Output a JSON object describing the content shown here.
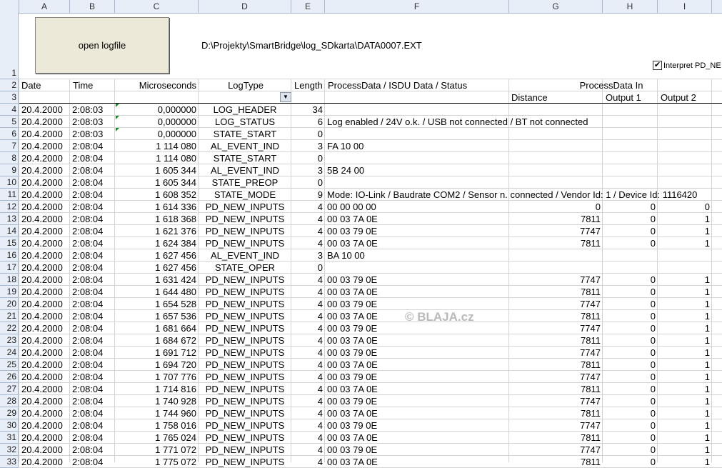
{
  "columns": [
    "A",
    "B",
    "C",
    "D",
    "E",
    "F",
    "G",
    "H",
    "I"
  ],
  "header_row1": {
    "button_label": "open logfile",
    "file_path": "D:\\Projekty\\SmartBridge\\log_SDkarta\\DATA0007.EXT",
    "checkbox_label": "Interpret PD_NE",
    "checkbox_mark": "✔"
  },
  "header_row2": {
    "date": "Date",
    "time": "Time",
    "micro": "Microseconds",
    "logtype": "LogType",
    "length": "Length",
    "process": "ProcessData / ISDU Data / Status",
    "pdin": "ProcessData In"
  },
  "header_row3": {
    "distance": "Distance",
    "out1": "Output 1",
    "out2": "Output 2",
    "filter_glyph": "▼"
  },
  "row_numbers": [
    "1",
    "2",
    "3",
    "4",
    "5",
    "6",
    "7",
    "8",
    "9",
    "10",
    "11",
    "12",
    "13",
    "14",
    "15",
    "16",
    "17",
    "18",
    "19",
    "20",
    "21",
    "22",
    "23",
    "24",
    "25",
    "26",
    "27",
    "28",
    "29",
    "30",
    "31",
    "32",
    "33"
  ],
  "rows": [
    {
      "date": "20.4.2000",
      "time": "2:08:03",
      "micro": "0,000000",
      "type": "LOG_HEADER",
      "len": "34",
      "data": "",
      "dist": "",
      "o1": "",
      "o2": ""
    },
    {
      "date": "20.4.2000",
      "time": "2:08:03",
      "micro": "0,000000",
      "type": "LOG_STATUS",
      "len": "6",
      "data": "Log enabled / 24V o.k. / USB not connected / BT not connected",
      "dist": "",
      "o1": "",
      "o2": ""
    },
    {
      "date": "20.4.2000",
      "time": "2:08:03",
      "micro": "0,000000",
      "type": "STATE_START",
      "len": "0",
      "data": "",
      "dist": "",
      "o1": "",
      "o2": ""
    },
    {
      "date": "20.4.2000",
      "time": "2:08:04",
      "micro": "1 114 080",
      "type": "AL_EVENT_IND",
      "len": "3",
      "data": "FA 10 00",
      "dist": "",
      "o1": "",
      "o2": ""
    },
    {
      "date": "20.4.2000",
      "time": "2:08:04",
      "micro": "1 114 080",
      "type": "STATE_START",
      "len": "0",
      "data": "",
      "dist": "",
      "o1": "",
      "o2": ""
    },
    {
      "date": "20.4.2000",
      "time": "2:08:04",
      "micro": "1 605 344",
      "type": "AL_EVENT_IND",
      "len": "3",
      "data": "5B 24 00",
      "dist": "",
      "o1": "",
      "o2": ""
    },
    {
      "date": "20.4.2000",
      "time": "2:08:04",
      "micro": "1 605 344",
      "type": "STATE_PREOP",
      "len": "0",
      "data": "",
      "dist": "",
      "o1": "",
      "o2": ""
    },
    {
      "date": "20.4.2000",
      "time": "2:08:04",
      "micro": "1 608 352",
      "type": "STATE_MODE",
      "len": "9",
      "data": "Mode: IO-Link / Baudrate COM2 / Sensor n. connected / Vendor Id: 1 / Device Id: 1116420",
      "dist": "",
      "o1": "",
      "o2": ""
    },
    {
      "date": "20.4.2000",
      "time": "2:08:04",
      "micro": "1 614 336",
      "type": "PD_NEW_INPUTS",
      "len": "4",
      "data": "00 00 00 00",
      "dist": "0",
      "o1": "0",
      "o2": "0"
    },
    {
      "date": "20.4.2000",
      "time": "2:08:04",
      "micro": "1 618 368",
      "type": "PD_NEW_INPUTS",
      "len": "4",
      "data": "00 03 7A 0E",
      "dist": "7811",
      "o1": "0",
      "o2": "1"
    },
    {
      "date": "20.4.2000",
      "time": "2:08:04",
      "micro": "1 621 376",
      "type": "PD_NEW_INPUTS",
      "len": "4",
      "data": "00 03 79 0E",
      "dist": "7747",
      "o1": "0",
      "o2": "1"
    },
    {
      "date": "20.4.2000",
      "time": "2:08:04",
      "micro": "1 624 384",
      "type": "PD_NEW_INPUTS",
      "len": "4",
      "data": "00 03 7A 0E",
      "dist": "7811",
      "o1": "0",
      "o2": "1"
    },
    {
      "date": "20.4.2000",
      "time": "2:08:04",
      "micro": "1 627 456",
      "type": "AL_EVENT_IND",
      "len": "3",
      "data": "BA 10 00",
      "dist": "",
      "o1": "",
      "o2": ""
    },
    {
      "date": "20.4.2000",
      "time": "2:08:04",
      "micro": "1 627 456",
      "type": "STATE_OPER",
      "len": "0",
      "data": "",
      "dist": "",
      "o1": "",
      "o2": ""
    },
    {
      "date": "20.4.2000",
      "time": "2:08:04",
      "micro": "1 631 424",
      "type": "PD_NEW_INPUTS",
      "len": "4",
      "data": "00 03 79 0E",
      "dist": "7747",
      "o1": "0",
      "o2": "1"
    },
    {
      "date": "20.4.2000",
      "time": "2:08:04",
      "micro": "1 644 480",
      "type": "PD_NEW_INPUTS",
      "len": "4",
      "data": "00 03 7A 0E",
      "dist": "7811",
      "o1": "0",
      "o2": "1"
    },
    {
      "date": "20.4.2000",
      "time": "2:08:04",
      "micro": "1 654 528",
      "type": "PD_NEW_INPUTS",
      "len": "4",
      "data": "00 03 79 0E",
      "dist": "7747",
      "o1": "0",
      "o2": "1"
    },
    {
      "date": "20.4.2000",
      "time": "2:08:04",
      "micro": "1 657 536",
      "type": "PD_NEW_INPUTS",
      "len": "4",
      "data": "00 03 7A 0E",
      "dist": "7811",
      "o1": "0",
      "o2": "1"
    },
    {
      "date": "20.4.2000",
      "time": "2:08:04",
      "micro": "1 681 664",
      "type": "PD_NEW_INPUTS",
      "len": "4",
      "data": "00 03 79 0E",
      "dist": "7747",
      "o1": "0",
      "o2": "1"
    },
    {
      "date": "20.4.2000",
      "time": "2:08:04",
      "micro": "1 684 672",
      "type": "PD_NEW_INPUTS",
      "len": "4",
      "data": "00 03 7A 0E",
      "dist": "7811",
      "o1": "0",
      "o2": "1"
    },
    {
      "date": "20.4.2000",
      "time": "2:08:04",
      "micro": "1 691 712",
      "type": "PD_NEW_INPUTS",
      "len": "4",
      "data": "00 03 79 0E",
      "dist": "7747",
      "o1": "0",
      "o2": "1"
    },
    {
      "date": "20.4.2000",
      "time": "2:08:04",
      "micro": "1 694 720",
      "type": "PD_NEW_INPUTS",
      "len": "4",
      "data": "00 03 7A 0E",
      "dist": "7811",
      "o1": "0",
      "o2": "1"
    },
    {
      "date": "20.4.2000",
      "time": "2:08:04",
      "micro": "1 707 776",
      "type": "PD_NEW_INPUTS",
      "len": "4",
      "data": "00 03 79 0E",
      "dist": "7747",
      "o1": "0",
      "o2": "1"
    },
    {
      "date": "20.4.2000",
      "time": "2:08:04",
      "micro": "1 714 816",
      "type": "PD_NEW_INPUTS",
      "len": "4",
      "data": "00 03 7A 0E",
      "dist": "7811",
      "o1": "0",
      "o2": "1"
    },
    {
      "date": "20.4.2000",
      "time": "2:08:04",
      "micro": "1 740 928",
      "type": "PD_NEW_INPUTS",
      "len": "4",
      "data": "00 03 79 0E",
      "dist": "7747",
      "o1": "0",
      "o2": "1"
    },
    {
      "date": "20.4.2000",
      "time": "2:08:04",
      "micro": "1 744 960",
      "type": "PD_NEW_INPUTS",
      "len": "4",
      "data": "00 03 7A 0E",
      "dist": "7811",
      "o1": "0",
      "o2": "1"
    },
    {
      "date": "20.4.2000",
      "time": "2:08:04",
      "micro": "1 758 016",
      "type": "PD_NEW_INPUTS",
      "len": "4",
      "data": "00 03 79 0E",
      "dist": "7747",
      "o1": "0",
      "o2": "1"
    },
    {
      "date": "20.4.2000",
      "time": "2:08:04",
      "micro": "1 765 024",
      "type": "PD_NEW_INPUTS",
      "len": "4",
      "data": "00 03 7A 0E",
      "dist": "7811",
      "o1": "0",
      "o2": "1"
    },
    {
      "date": "20.4.2000",
      "time": "2:08:04",
      "micro": "1 771 072",
      "type": "PD_NEW_INPUTS",
      "len": "4",
      "data": "00 03 79 0E",
      "dist": "7747",
      "o1": "0",
      "o2": "1"
    },
    {
      "date": "20.4.2000",
      "time": "2:08:04",
      "micro": "1 775 072",
      "type": "PD_NEW_INPUTS",
      "len": "4",
      "data": "00 03 7A 0E",
      "dist": "7811",
      "o1": "0",
      "o2": "1"
    }
  ],
  "watermark": "© BLAJA.cz",
  "colors": {
    "header_bg": "#e8eef7",
    "button_bg": "#ece9d8",
    "error_triangle": "#1a8a2a",
    "grid": "#d4d4d4"
  }
}
